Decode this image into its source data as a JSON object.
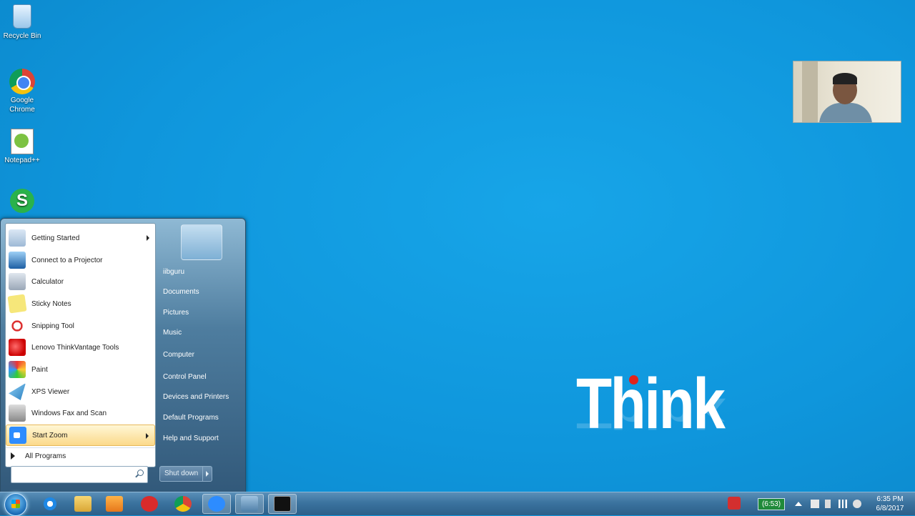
{
  "desktop": {
    "icons": [
      {
        "label": "Recycle Bin"
      },
      {
        "label": "Google Chrome"
      },
      {
        "label": "Notepad++"
      },
      {
        "label": ""
      }
    ],
    "brand_logo": "Think"
  },
  "start_menu": {
    "programs": [
      {
        "label": "Getting Started",
        "icon": "getting-started-icon",
        "has_submenu": true
      },
      {
        "label": "Connect to a Projector",
        "icon": "projector-icon"
      },
      {
        "label": "Calculator",
        "icon": "calculator-icon"
      },
      {
        "label": "Sticky Notes",
        "icon": "sticky-notes-icon"
      },
      {
        "label": "Snipping Tool",
        "icon": "snipping-tool-icon"
      },
      {
        "label": "Lenovo ThinkVantage Tools",
        "icon": "lenovo-icon"
      },
      {
        "label": "Paint",
        "icon": "paint-icon"
      },
      {
        "label": "XPS Viewer",
        "icon": "xps-viewer-icon"
      },
      {
        "label": "Windows Fax and Scan",
        "icon": "fax-scan-icon"
      },
      {
        "label": "Start Zoom",
        "icon": "zoom-icon",
        "has_submenu": true,
        "highlighted": true
      }
    ],
    "all_programs": "All Programs",
    "search": {
      "value": "",
      "placeholder": ""
    },
    "right_items": [
      {
        "label": "iibguru"
      },
      {
        "label": "Documents"
      },
      {
        "label": "Pictures"
      },
      {
        "label": "Music"
      },
      {
        "label": "Computer"
      },
      {
        "label": "Control Panel"
      },
      {
        "label": "Devices and Printers"
      },
      {
        "label": "Default Programs"
      },
      {
        "label": "Help and Support"
      }
    ],
    "shutdown_label": "Shut down"
  },
  "taskbar": {
    "pinned": [
      "ie-icon",
      "explorer-icon",
      "media-player-icon",
      "cloud-app-icon",
      "chrome-icon",
      "zoom-icon",
      "remote-desktop-icon",
      "cmd-icon"
    ],
    "battery_text": "(6:53)",
    "clock": {
      "time": "6:35 PM",
      "date": "6/8/2017"
    }
  },
  "colors": {
    "desktop": "#0f96dc",
    "taskbar": "#3b739f",
    "highlight": "#fbd98a"
  }
}
